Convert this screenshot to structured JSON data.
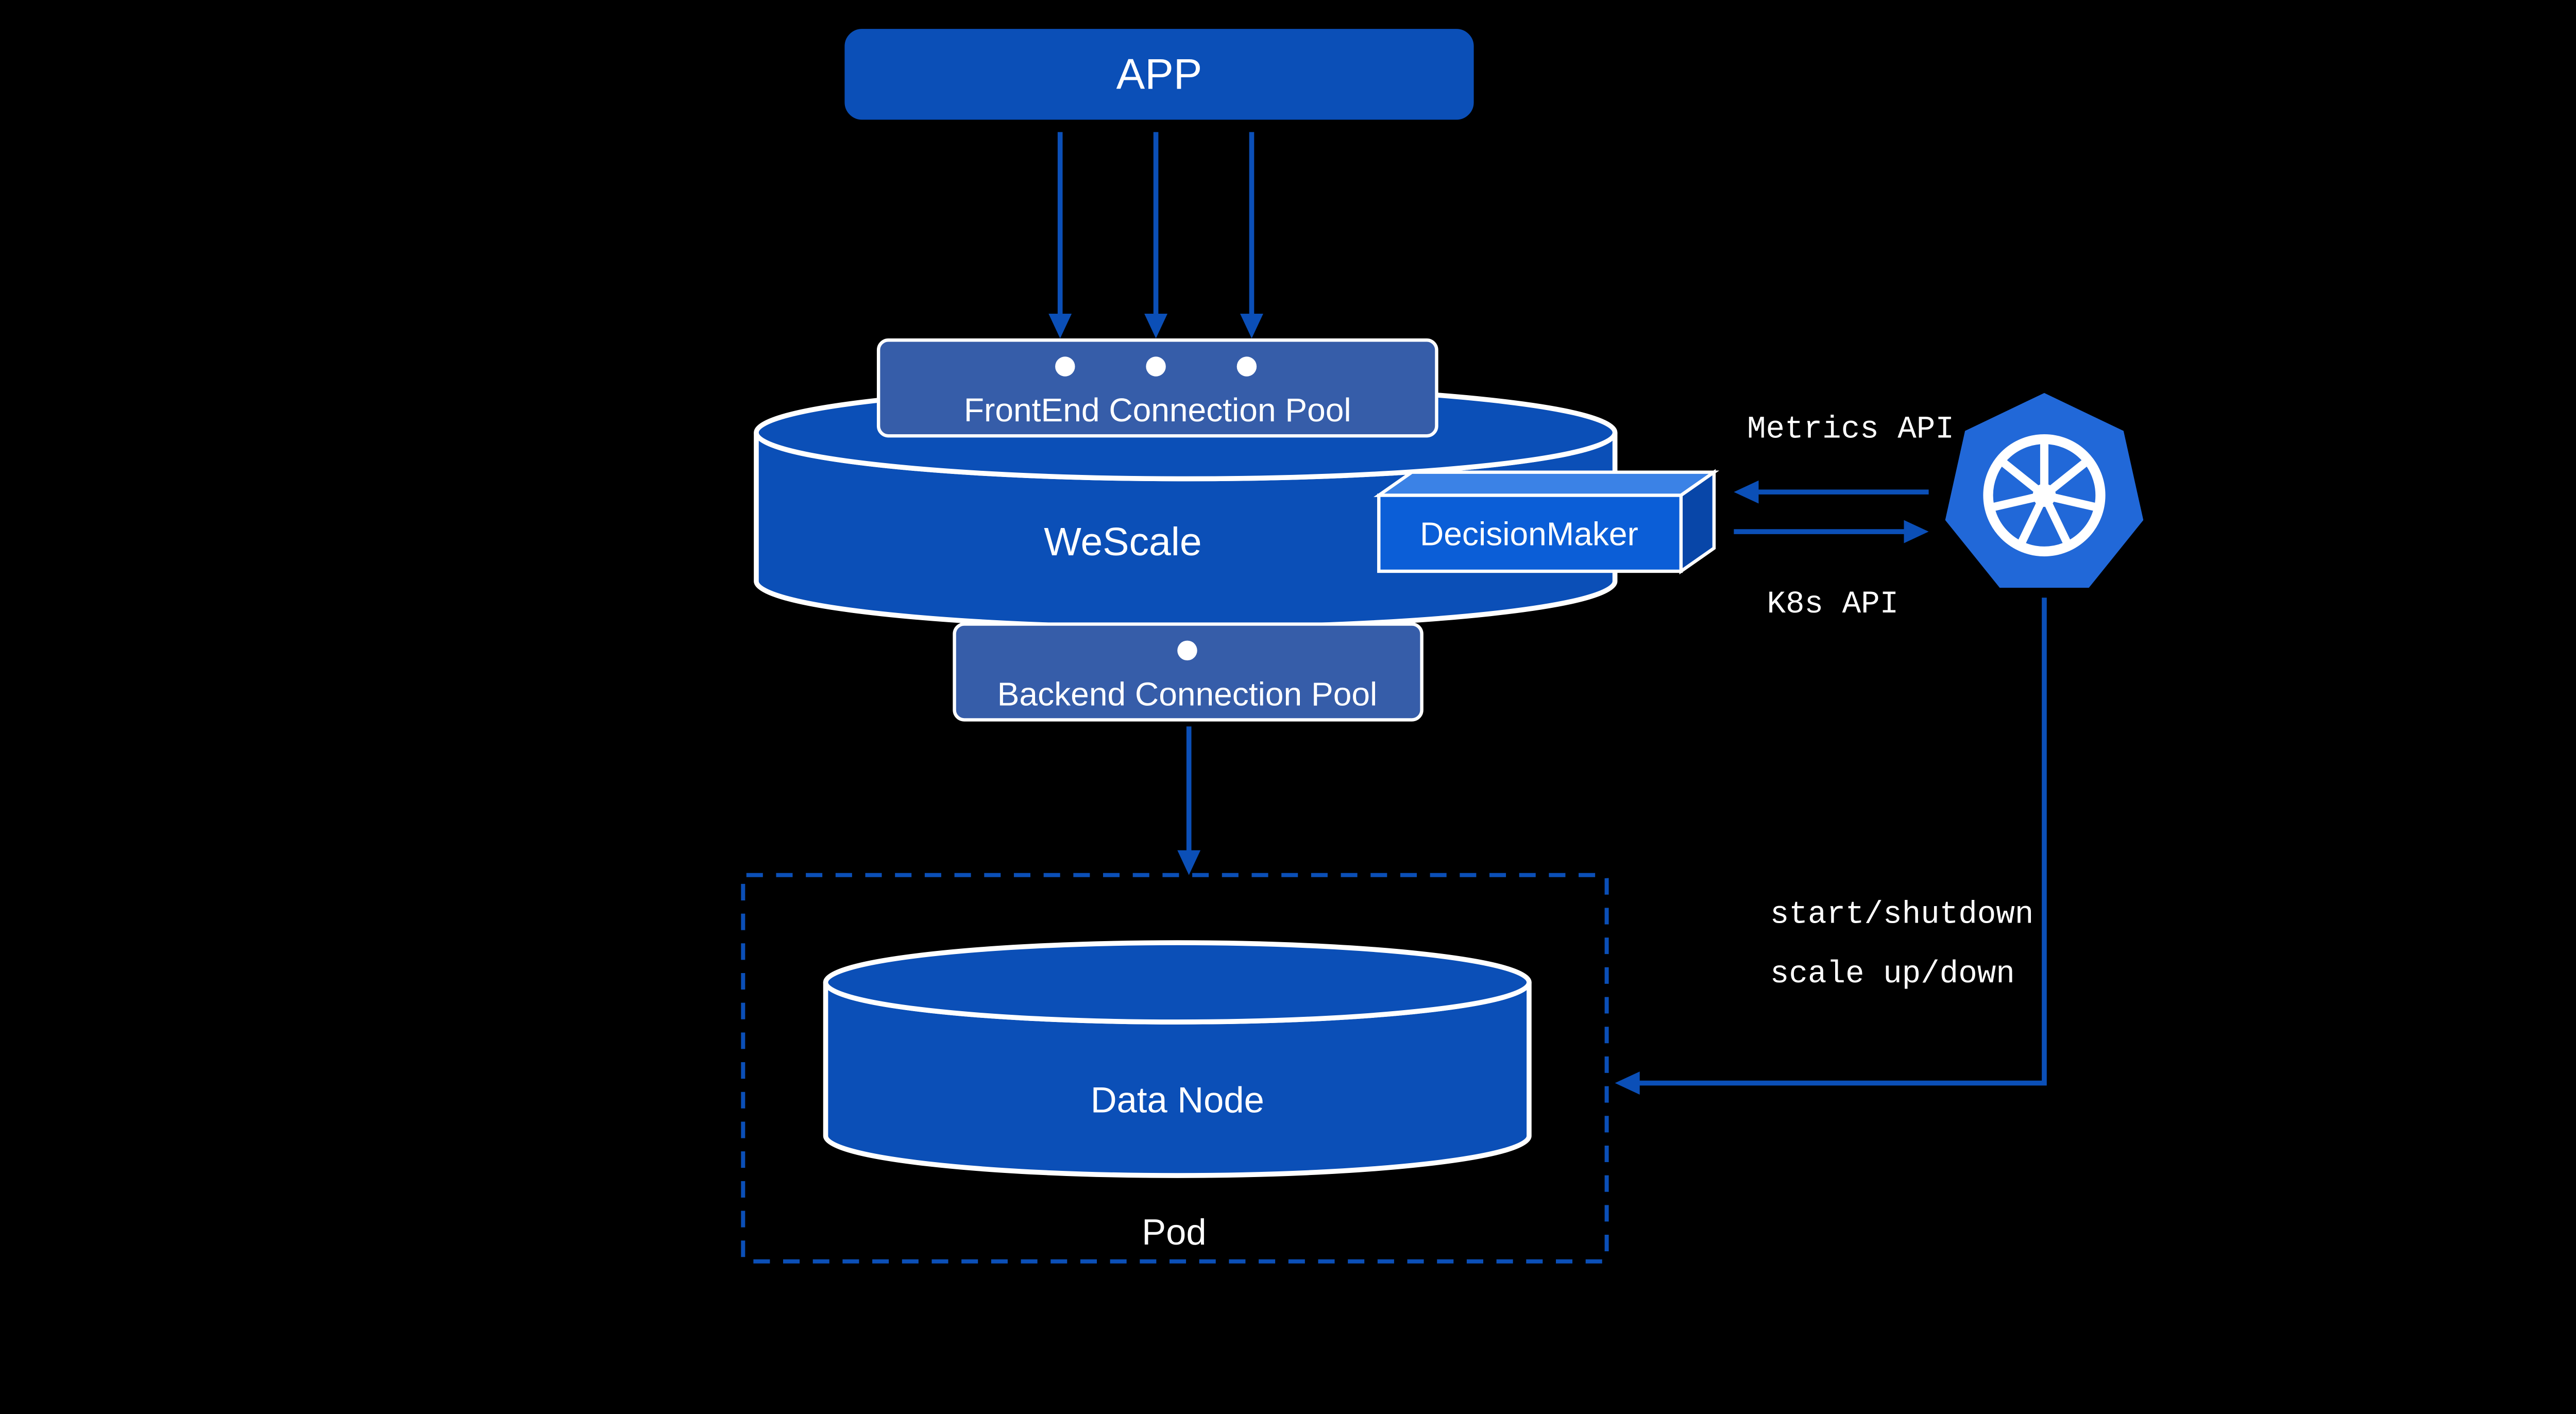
{
  "app": {
    "label": "APP"
  },
  "wescale": {
    "label": "WeScale",
    "frontend_pool_label": "FrontEnd Connection Pool",
    "backend_pool_label": "Backend Connection Pool",
    "decision_maker_label": "DecisionMaker"
  },
  "apis": {
    "metrics_label": "Metrics API",
    "k8s_label": "K8s API"
  },
  "pod": {
    "label": "Pod",
    "data_node_label": "Data Node"
  },
  "actions": {
    "line1": "start/shutdown",
    "line2": "scale up/down"
  },
  "colors": {
    "primary": "#0B4FB7",
    "pool": "#365DA9",
    "dm_face": "#0B5ED7",
    "dm_top": "#3B82E6",
    "dm_side": "#0846A8",
    "k8s": "#2168D8",
    "bg": "#000000",
    "text": "#FFFFFF"
  }
}
